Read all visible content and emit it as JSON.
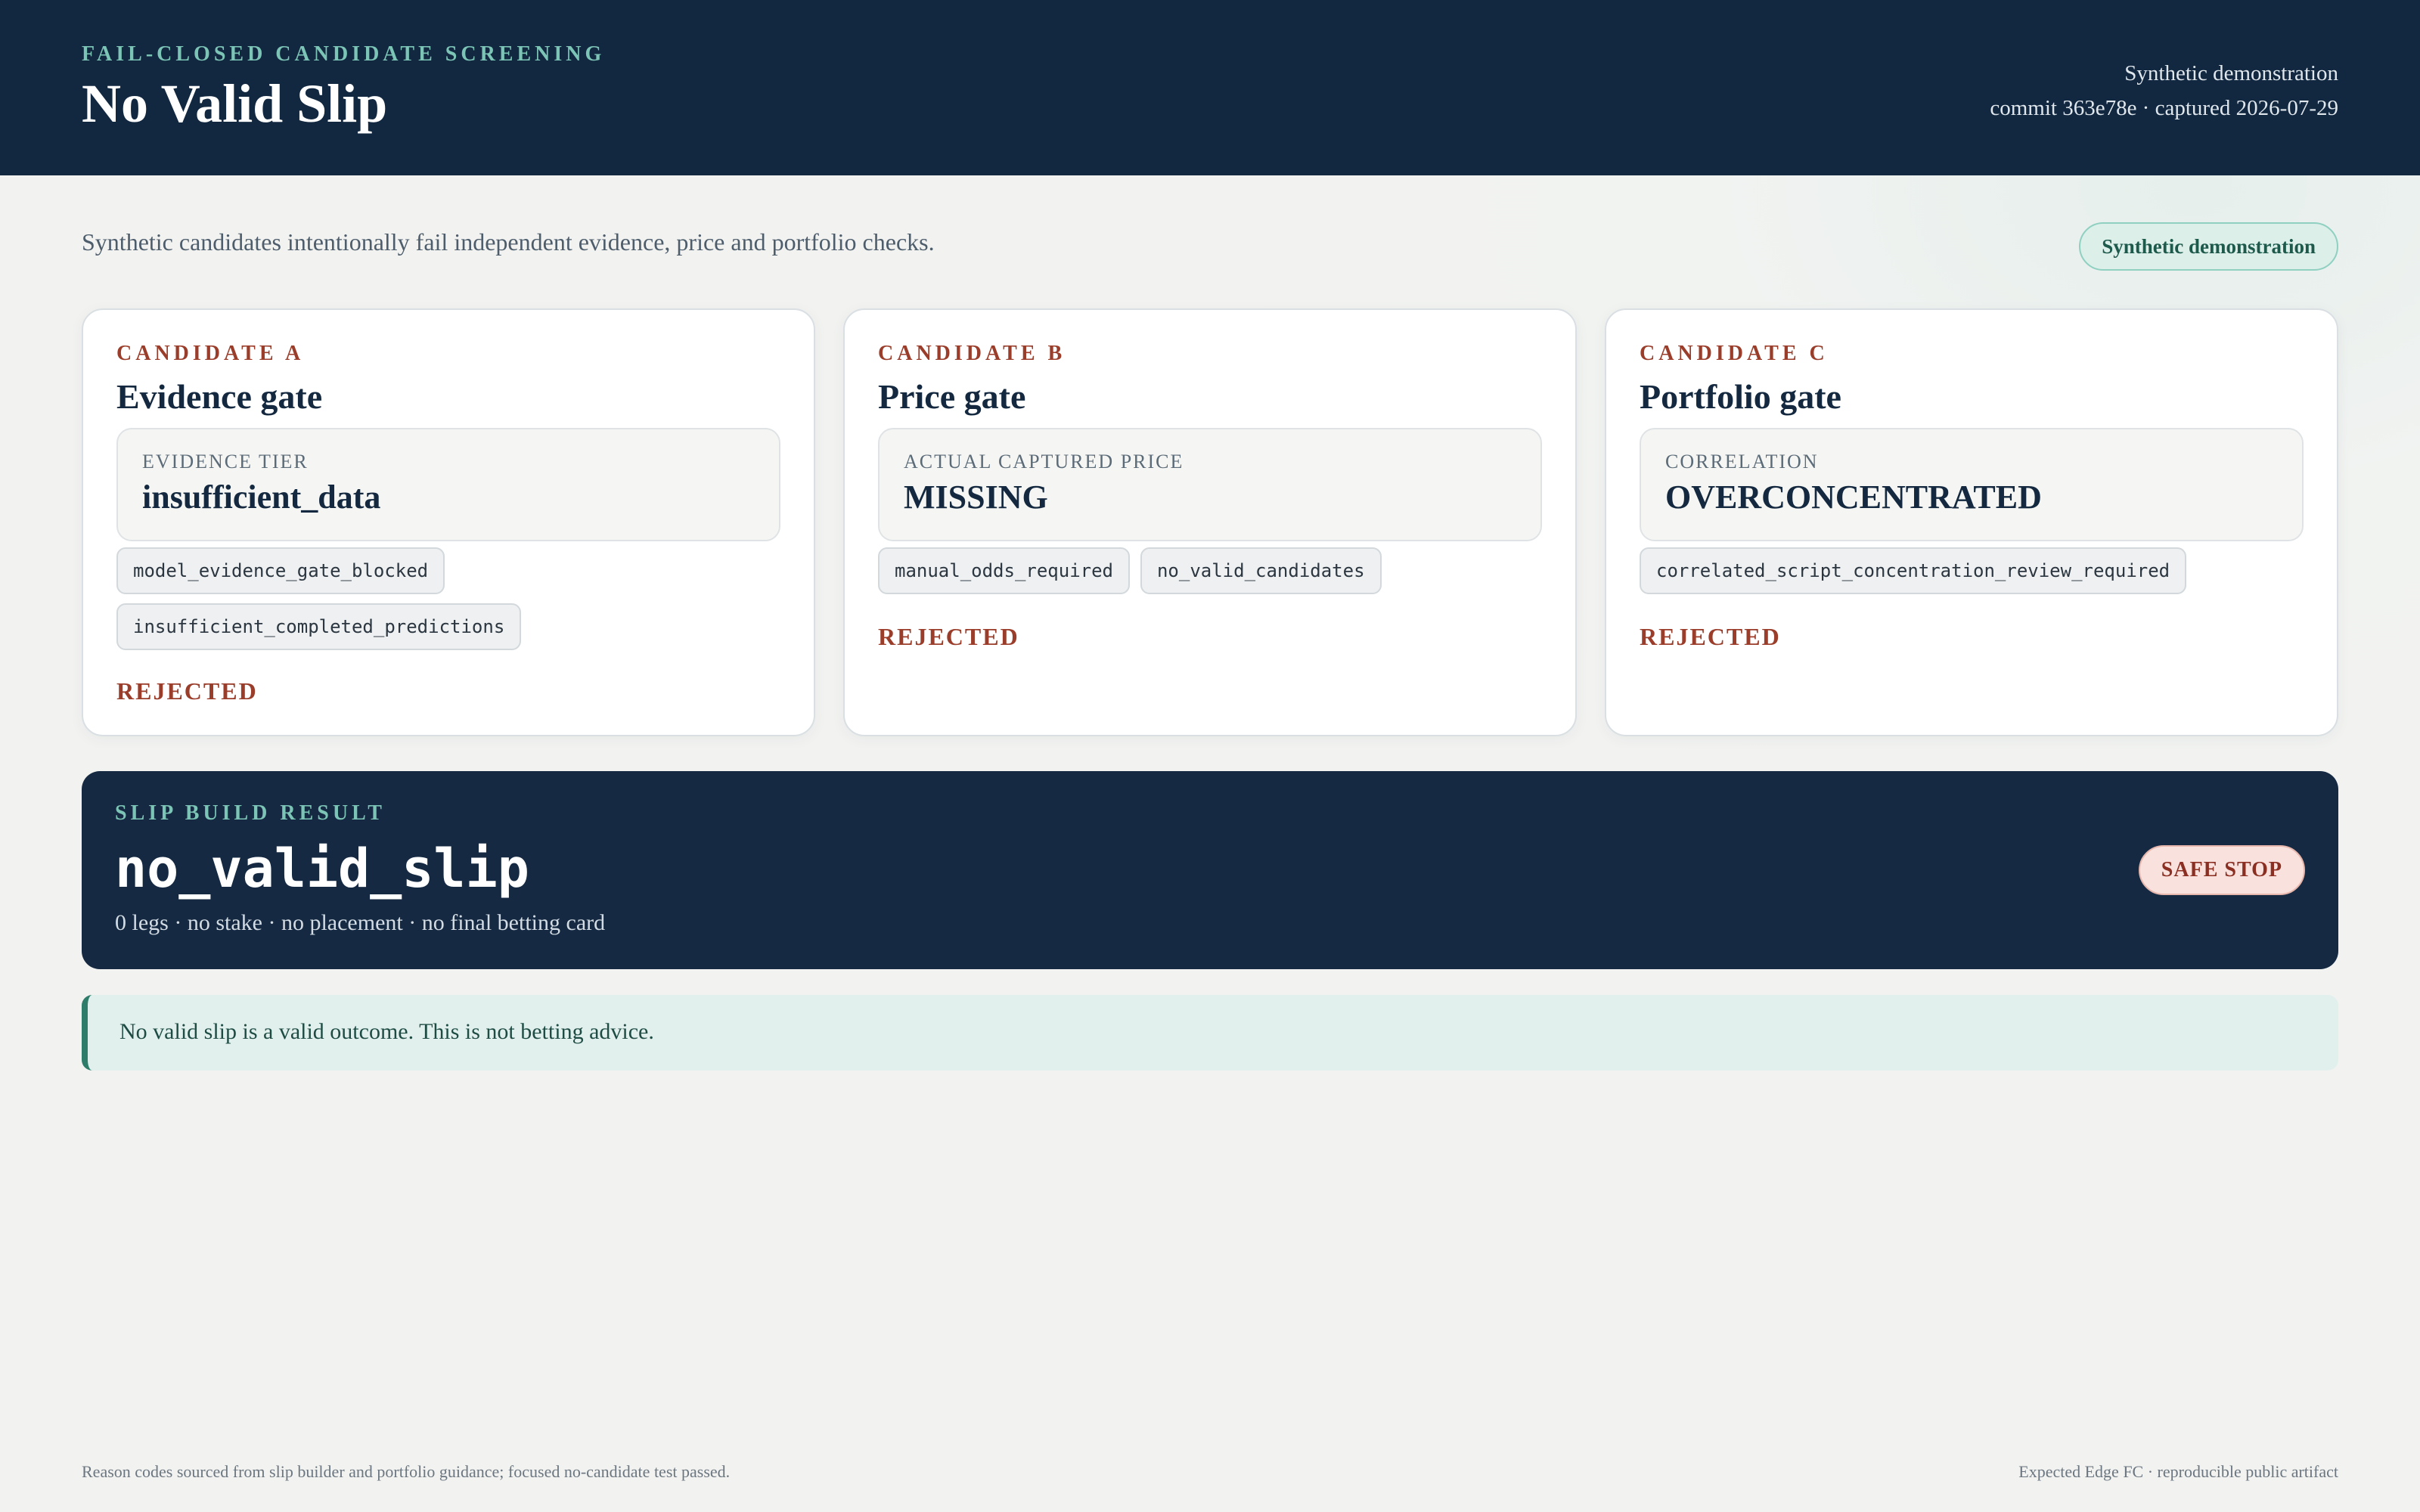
{
  "header": {
    "eyebrow": "FAIL-CLOSED CANDIDATE SCREENING",
    "title": "No Valid Slip",
    "meta_line1": "Synthetic demonstration",
    "meta_line2": "commit 363e78e · captured 2026-07-29"
  },
  "intro": {
    "text": "Synthetic candidates intentionally fail independent evidence, price and portfolio checks.",
    "badge": "Synthetic demonstration"
  },
  "cards": [
    {
      "label": "CANDIDATE A",
      "title": "Evidence gate",
      "metric_label": "EVIDENCE TIER",
      "metric_value": "insufficient_data",
      "codes": [
        "model_evidence_gate_blocked",
        "insufficient_completed_predictions"
      ],
      "status": "REJECTED"
    },
    {
      "label": "CANDIDATE B",
      "title": "Price gate",
      "metric_label": "ACTUAL CAPTURED PRICE",
      "metric_value": "MISSING",
      "codes": [
        "manual_odds_required",
        "no_valid_candidates"
      ],
      "status": "REJECTED"
    },
    {
      "label": "CANDIDATE C",
      "title": "Portfolio gate",
      "metric_label": "CORRELATION",
      "metric_value": "OVERCONCENTRATED",
      "codes": [
        "correlated_script_concentration_review_required"
      ],
      "status": "REJECTED"
    }
  ],
  "result": {
    "label": "SLIP BUILD RESULT",
    "value": "no_valid_slip",
    "summary": "0 legs · no stake · no placement · no final betting card",
    "badge": "SAFE STOP"
  },
  "notice": {
    "text": "No valid slip is a valid outcome. This is not betting advice."
  },
  "footer": {
    "left": "Reason codes sourced from slip builder and portfolio guidance; focused no-candidate test passed.",
    "right": "Expected Edge FC · reproducible public artifact"
  },
  "colors": {
    "header_bg": "#122840",
    "accent_teal": "#7cc4b6",
    "rejected_red": "#9a3e2b"
  }
}
